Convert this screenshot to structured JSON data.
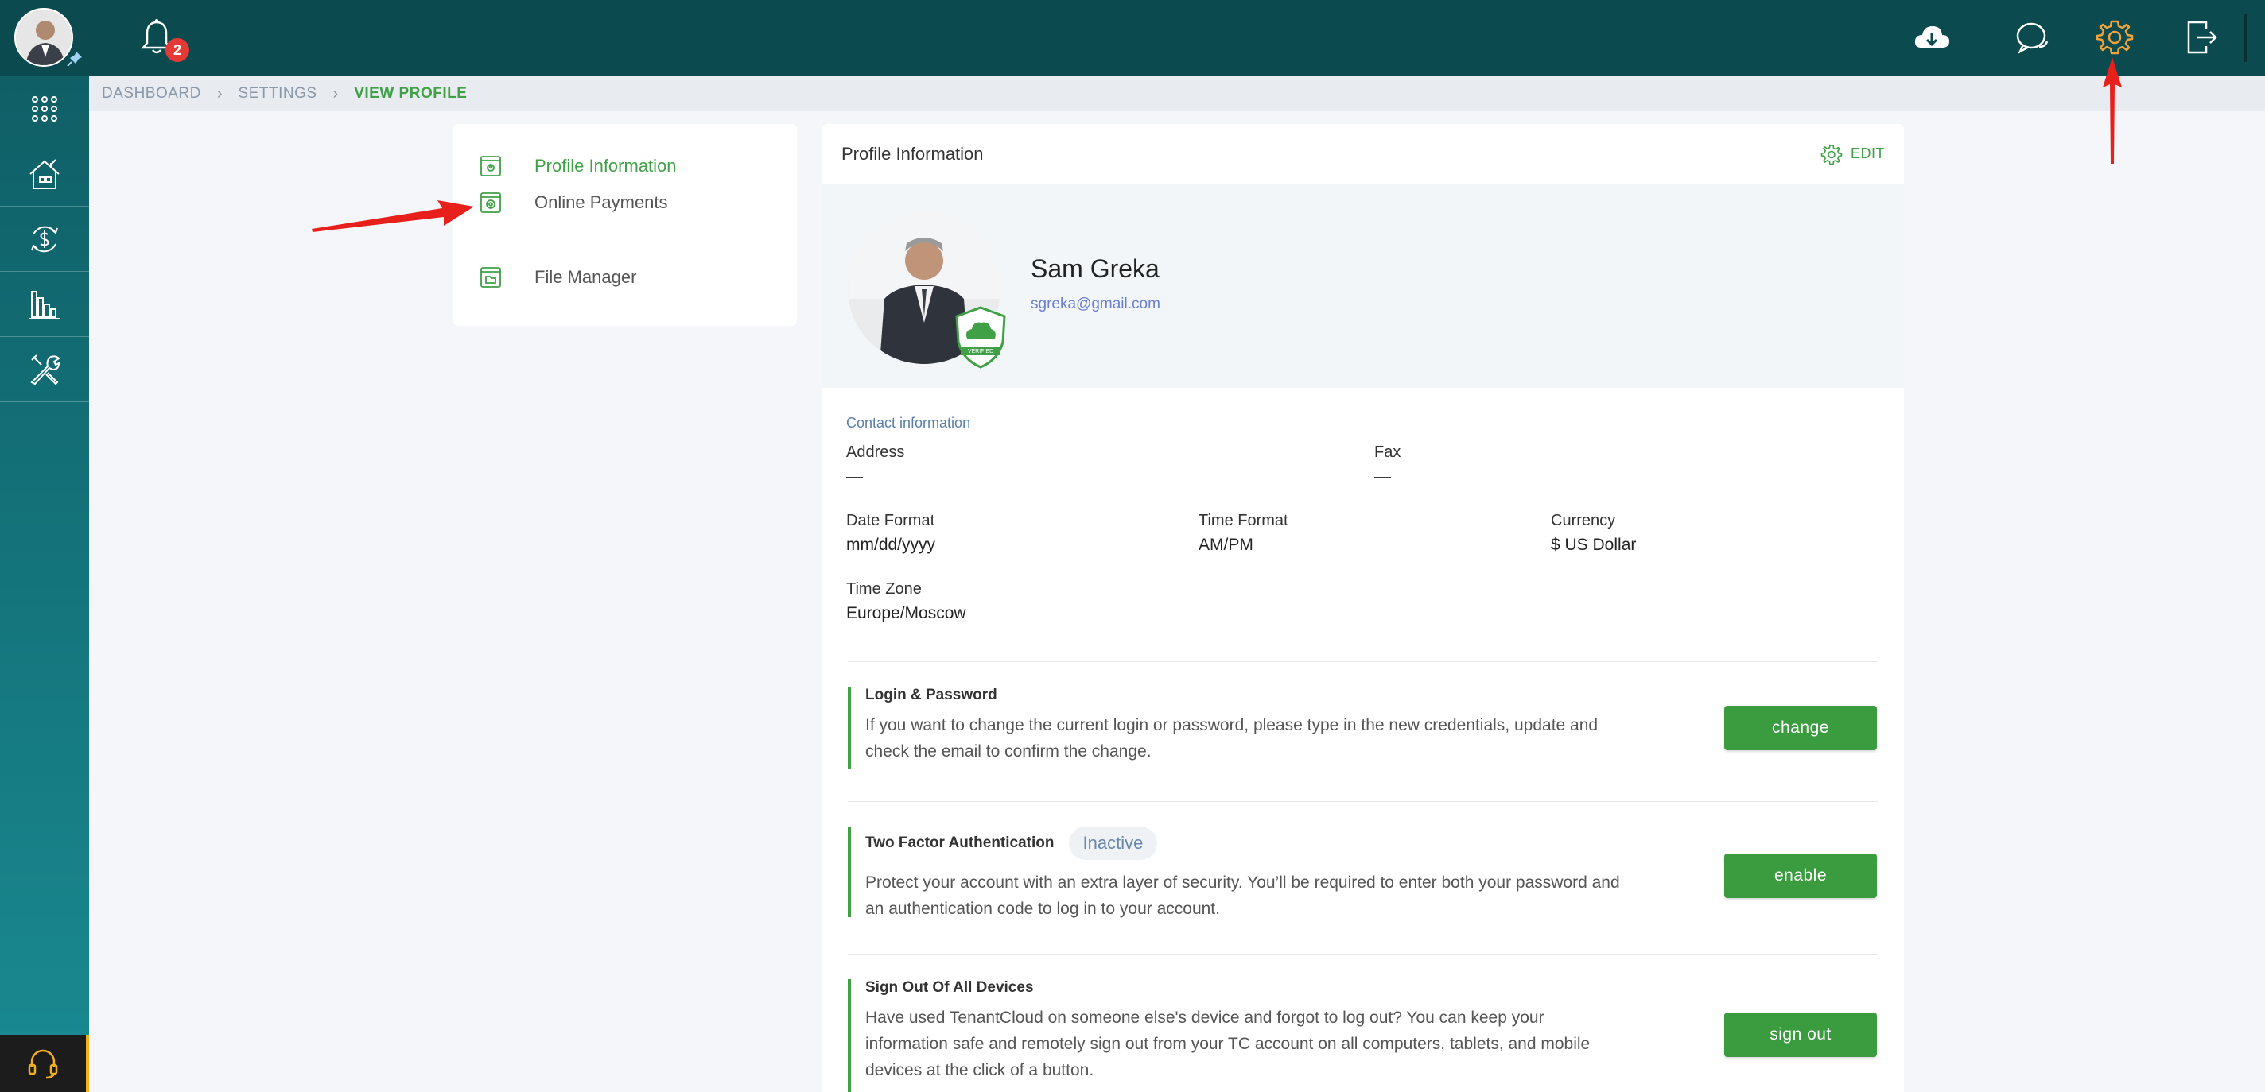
{
  "notifications": {
    "count": "2"
  },
  "breadcrumb": [
    "DASHBOARD",
    "SETTINGS",
    "VIEW PROFILE"
  ],
  "menu": {
    "items": [
      {
        "label": "Profile Information",
        "active": true
      },
      {
        "label": "Online Payments",
        "active": false
      },
      {
        "label": "File Manager",
        "active": false
      }
    ]
  },
  "card": {
    "title": "Profile Information",
    "edit_label": "EDIT"
  },
  "profile": {
    "name": "Sam Greka",
    "email": "sgreka@gmail.com",
    "badge_text": "VERIFIED"
  },
  "contact": {
    "section_label": "Contact information",
    "address_label": "Address",
    "address_value": "—",
    "fax_label": "Fax",
    "fax_value": "—",
    "date_format_label": "Date Format",
    "date_format_value": "mm/dd/yyyy",
    "time_format_label": "Time Format",
    "time_format_value": "AM/PM",
    "currency_label": "Currency",
    "currency_value": "$ US Dollar",
    "timezone_label": "Time Zone",
    "timezone_value": "Europe/Moscow"
  },
  "security": {
    "login": {
      "title": "Login & Password",
      "text": "If you want to change the current login or password, please type in the new credentials, update and check the email to confirm the change.",
      "button": "change"
    },
    "twofa": {
      "title": "Two Factor Authentication",
      "status": "Inactive",
      "text": "Protect your account with an extra layer of security. You’ll be required to enter both your password and an authentication code to log in to your account.",
      "button": "enable"
    },
    "signout": {
      "title": "Sign Out Of All Devices",
      "text": "Have used TenantCloud on someone else's device and forgot to log out? You can keep your information safe and remotely sign out from your TC account on all computers, tablets, and mobile devices at the click of a button.",
      "button": "sign out"
    }
  },
  "colors": {
    "topbar": "#0b4a4f",
    "accent_green": "#3fa046",
    "settings_icon_active": "#f2a33a",
    "annotation_arrow": "#e8201c"
  },
  "icons": {
    "top": [
      "bell-icon",
      "cloud-download-icon",
      "chat-icon",
      "gear-icon",
      "logout-icon"
    ],
    "sidebar": [
      "apps-grid-icon",
      "properties-icon",
      "payments-icon",
      "reports-icon",
      "tools-icon",
      "headset-icon"
    ]
  }
}
